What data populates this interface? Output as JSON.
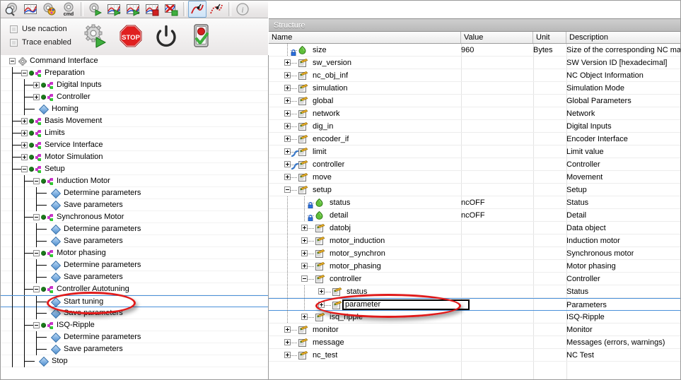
{
  "toolbar": {
    "buttons": [
      {
        "name": "inspect-icon",
        "title": "Inspect"
      },
      {
        "name": "chart-icon",
        "title": "Chart"
      },
      {
        "name": "paint-icon",
        "title": "Paint"
      },
      {
        "name": "cmd-icon",
        "title": "cmd",
        "text": "cmd"
      },
      {
        "name": "gear-play-icon",
        "title": "Run"
      },
      {
        "name": "chart-play-1-icon",
        "title": "Start trace"
      },
      {
        "name": "chart-play-2-icon",
        "title": "Start trace 2"
      },
      {
        "name": "chart-stop-icon",
        "title": "Stop trace"
      },
      {
        "name": "chart-delete-icon",
        "title": "Delete trace"
      },
      {
        "name": "curve-solid-icon",
        "title": "Curve",
        "active": true
      },
      {
        "name": "curve-dotted-icon",
        "title": "Curve dotted"
      },
      {
        "name": "info-icon",
        "title": "Info"
      }
    ]
  },
  "controls": {
    "checkboxes": [
      {
        "label": "Use ncaction",
        "checked": false,
        "enabled": false
      },
      {
        "label": "Trace enabled",
        "checked": false,
        "enabled": false
      }
    ],
    "action_buttons": [
      {
        "name": "gear-start-icon",
        "title": "Start"
      },
      {
        "name": "stop-sign-icon",
        "title": "Stop"
      },
      {
        "name": "power-icon",
        "title": "Power"
      },
      {
        "name": "traffic-light-icon",
        "title": "Status"
      }
    ]
  },
  "command_tree": {
    "root": "Command Interface",
    "selected": "Start tuning",
    "nodes": [
      {
        "label": "Command Interface",
        "depth": 0,
        "type": "gear",
        "expander": "minus"
      },
      {
        "label": "Preparation",
        "depth": 1,
        "type": "node",
        "expander": "minus"
      },
      {
        "label": "Digital Inputs",
        "depth": 2,
        "type": "node",
        "expander": "plus"
      },
      {
        "label": "Controller",
        "depth": 2,
        "type": "node",
        "expander": "plus"
      },
      {
        "label": "Homing",
        "depth": 2,
        "type": "leaf",
        "expander": "none"
      },
      {
        "label": "Basis Movement",
        "depth": 1,
        "type": "node",
        "expander": "plus"
      },
      {
        "label": "Limits",
        "depth": 1,
        "type": "node",
        "expander": "plus"
      },
      {
        "label": "Service Interface",
        "depth": 1,
        "type": "node",
        "expander": "plus"
      },
      {
        "label": "Motor Simulation",
        "depth": 1,
        "type": "node",
        "expander": "plus"
      },
      {
        "label": "Setup",
        "depth": 1,
        "type": "node",
        "expander": "minus"
      },
      {
        "label": "Induction Motor",
        "depth": 2,
        "type": "node",
        "expander": "minus"
      },
      {
        "label": "Determine parameters",
        "depth": 3,
        "type": "leaf",
        "expander": "none"
      },
      {
        "label": "Save parameters",
        "depth": 3,
        "type": "leaf",
        "expander": "none"
      },
      {
        "label": "Synchronous Motor",
        "depth": 2,
        "type": "node",
        "expander": "minus"
      },
      {
        "label": "Determine parameters",
        "depth": 3,
        "type": "leaf",
        "expander": "none"
      },
      {
        "label": "Save parameters",
        "depth": 3,
        "type": "leaf",
        "expander": "none"
      },
      {
        "label": "Motor phasing",
        "depth": 2,
        "type": "node",
        "expander": "minus"
      },
      {
        "label": "Determine parameters",
        "depth": 3,
        "type": "leaf",
        "expander": "none"
      },
      {
        "label": "Save parameters",
        "depth": 3,
        "type": "leaf",
        "expander": "none"
      },
      {
        "label": "Controller Autotuning",
        "depth": 2,
        "type": "node",
        "expander": "minus"
      },
      {
        "label": "Start tuning",
        "depth": 3,
        "type": "leaf",
        "expander": "none",
        "selected": true,
        "annotated": true
      },
      {
        "label": "Save parameters",
        "depth": 3,
        "type": "leaf",
        "expander": "none"
      },
      {
        "label": "ISQ-Ripple",
        "depth": 2,
        "type": "node",
        "expander": "minus"
      },
      {
        "label": "Determine parameters",
        "depth": 3,
        "type": "leaf",
        "expander": "none"
      },
      {
        "label": "Save parameters",
        "depth": 3,
        "type": "leaf",
        "expander": "none"
      },
      {
        "label": "Stop",
        "depth": 2,
        "type": "leaf",
        "expander": "none"
      }
    ]
  },
  "structure": {
    "panel_title": "Structure",
    "columns": [
      "Name",
      "Value",
      "Unit",
      "Description"
    ],
    "editing_row_value": "parameter",
    "rows": [
      {
        "name": "size",
        "value": "960",
        "unit": "Bytes",
        "desc": "Size of the corresponding NC man",
        "depth": 1,
        "expander": "none",
        "icon": "leaf",
        "lock": true
      },
      {
        "name": "sw_version",
        "value": "",
        "unit": "",
        "desc": "SW Version ID [hexadecimal]",
        "depth": 1,
        "expander": "plus",
        "icon": "doc"
      },
      {
        "name": "nc_obj_inf",
        "value": "",
        "unit": "",
        "desc": "NC Object Information",
        "depth": 1,
        "expander": "plus",
        "icon": "doc"
      },
      {
        "name": "simulation",
        "value": "",
        "unit": "",
        "desc": "Simulation Mode",
        "depth": 1,
        "expander": "plus",
        "icon": "doc"
      },
      {
        "name": "global",
        "value": "",
        "unit": "",
        "desc": "Global Parameters",
        "depth": 1,
        "expander": "plus",
        "icon": "doc"
      },
      {
        "name": "network",
        "value": "",
        "unit": "",
        "desc": "Network",
        "depth": 1,
        "expander": "plus",
        "icon": "doc"
      },
      {
        "name": "dig_in",
        "value": "",
        "unit": "",
        "desc": "Digital Inputs",
        "depth": 1,
        "expander": "plus",
        "icon": "doc"
      },
      {
        "name": "encoder_if",
        "value": "",
        "unit": "",
        "desc": "Encoder Interface",
        "depth": 1,
        "expander": "plus",
        "icon": "doc"
      },
      {
        "name": "limit",
        "value": "",
        "unit": "",
        "desc": "Limit value",
        "depth": 1,
        "expander": "plus",
        "icon": "doc",
        "curve": true
      },
      {
        "name": "controller",
        "value": "",
        "unit": "",
        "desc": "Controller",
        "depth": 1,
        "expander": "plus",
        "icon": "doc",
        "curve": true
      },
      {
        "name": "move",
        "value": "",
        "unit": "",
        "desc": "Movement",
        "depth": 1,
        "expander": "plus",
        "icon": "doc"
      },
      {
        "name": "setup",
        "value": "",
        "unit": "",
        "desc": "Setup",
        "depth": 1,
        "expander": "minus",
        "icon": "doc"
      },
      {
        "name": "status",
        "value": "ncOFF",
        "unit": "",
        "desc": "Status",
        "depth": 2,
        "expander": "none",
        "icon": "leaf",
        "lock": true
      },
      {
        "name": "detail",
        "value": "ncOFF",
        "unit": "",
        "desc": "Detail",
        "depth": 2,
        "expander": "none",
        "icon": "leaf",
        "lock": true
      },
      {
        "name": "datobj",
        "value": "",
        "unit": "",
        "desc": "Data object",
        "depth": 2,
        "expander": "plus",
        "icon": "doc"
      },
      {
        "name": "motor_induction",
        "value": "",
        "unit": "",
        "desc": "Induction motor",
        "depth": 2,
        "expander": "plus",
        "icon": "doc"
      },
      {
        "name": "motor_synchron",
        "value": "",
        "unit": "",
        "desc": "Synchronous motor",
        "depth": 2,
        "expander": "plus",
        "icon": "doc"
      },
      {
        "name": "motor_phasing",
        "value": "",
        "unit": "",
        "desc": "Motor phasing",
        "depth": 2,
        "expander": "plus",
        "icon": "doc"
      },
      {
        "name": "controller",
        "value": "",
        "unit": "",
        "desc": "Controller",
        "depth": 2,
        "expander": "minus",
        "icon": "doc"
      },
      {
        "name": "status",
        "value": "",
        "unit": "",
        "desc": "Status",
        "depth": 3,
        "expander": "plus",
        "icon": "doc"
      },
      {
        "name": "parameter",
        "value": "",
        "unit": "",
        "desc": "Parameters",
        "depth": 3,
        "expander": "plus",
        "icon": "doc",
        "editing": true,
        "selected": true,
        "annotated": true
      },
      {
        "name": "isq_ripple",
        "value": "",
        "unit": "",
        "desc": "ISQ-Ripple",
        "depth": 2,
        "expander": "plus",
        "icon": "doc"
      },
      {
        "name": "monitor",
        "value": "",
        "unit": "",
        "desc": "Monitor",
        "depth": 1,
        "expander": "plus",
        "icon": "doc"
      },
      {
        "name": "message",
        "value": "",
        "unit": "",
        "desc": "Messages (errors, warnings)",
        "depth": 1,
        "expander": "plus",
        "icon": "doc"
      },
      {
        "name": "nc_test",
        "value": "",
        "unit": "",
        "desc": "NC Test",
        "depth": 1,
        "expander": "plus",
        "icon": "doc"
      }
    ]
  },
  "colors": {
    "selection_border": "#4a90d9",
    "annotation": "#e01b1b",
    "node_green": "#1c7a1c",
    "titlebar": "#b9b9b9"
  }
}
